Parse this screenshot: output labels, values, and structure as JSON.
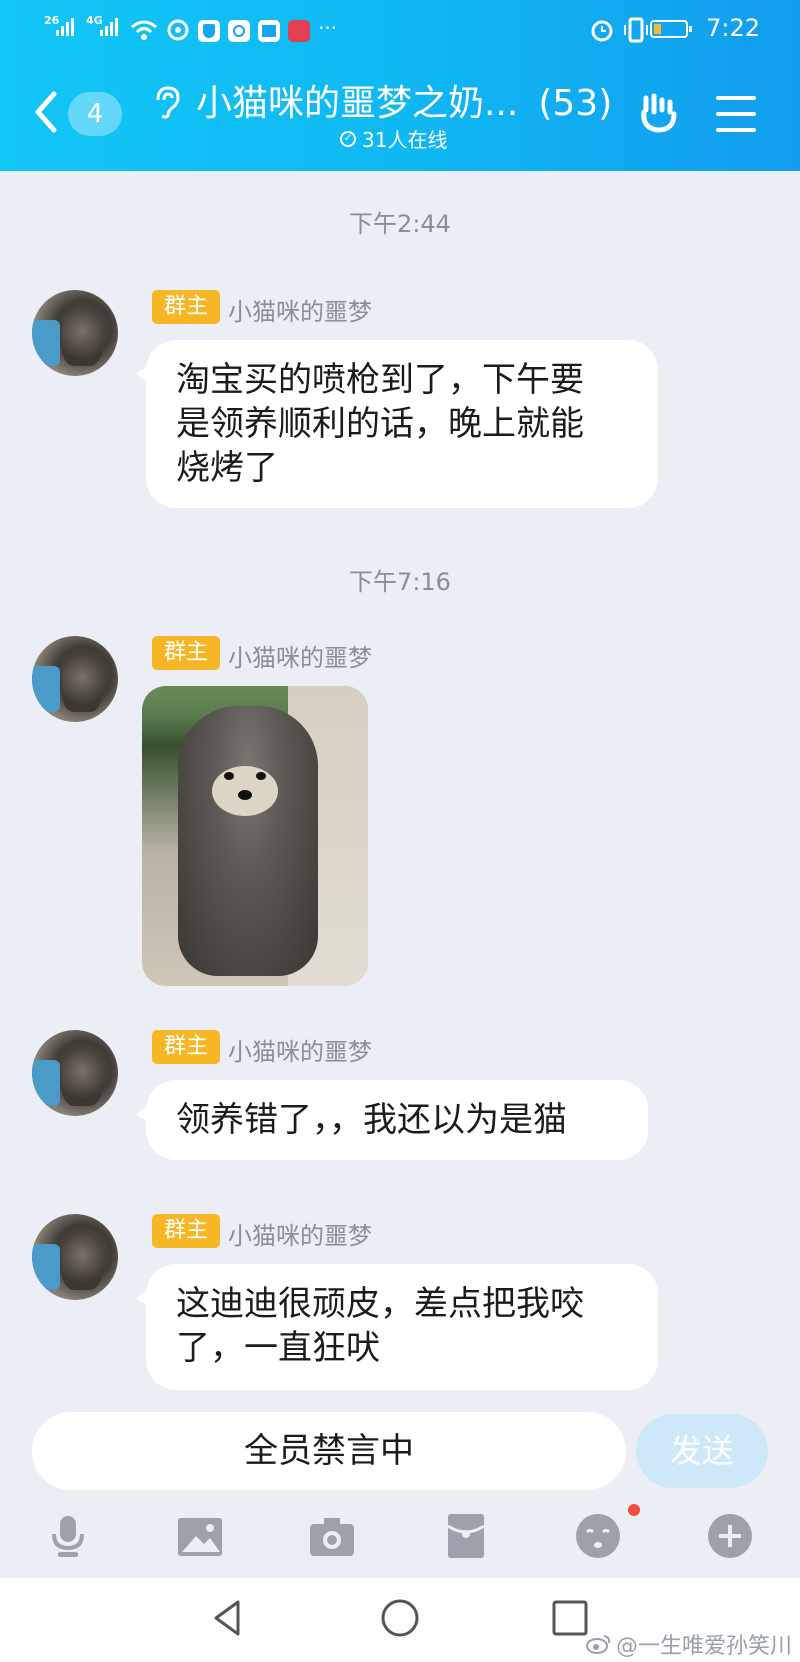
{
  "status_bar": {
    "sim1": "26",
    "sim2": "4G",
    "time": "7:22"
  },
  "header": {
    "unread_count": "4",
    "title": "小猫咪的噩梦之奶...",
    "member_count": "(53)",
    "online_text": "31人在线"
  },
  "messages": [
    {
      "timestamp": "下午2:44",
      "role_badge": "群主",
      "sender": "小猫咪的噩梦",
      "lines": [
        "淘宝买的喷枪到了，下午要",
        "是领养顺利的话，晚上就能",
        "烧烤了"
      ]
    },
    {
      "timestamp": "下午7:16",
      "role_badge": "群主",
      "sender": "小猫咪的噩梦",
      "image": "poodle-dog-photo"
    },
    {
      "role_badge": "群主",
      "sender": "小猫咪的噩梦",
      "lines": [
        "领养错了，，我还以为是猫"
      ]
    },
    {
      "role_badge": "群主",
      "sender": "小猫咪的噩梦",
      "lines": [
        "这迪迪很顽皮，差点把我咬",
        "了，一直狂吠"
      ]
    }
  ],
  "input": {
    "muted_text": "全员禁言中",
    "send_label": "发送"
  },
  "toolbar": [
    "microphone-icon",
    "image-icon",
    "camera-icon",
    "red-packet-icon",
    "emoji-icon",
    "plus-icon"
  ],
  "watermark": "@一生唯爱孙笑川",
  "colors": {
    "header_start": "#12c6f6",
    "header_end": "#129cee",
    "badge": "#f7b625",
    "background": "#eceef5"
  }
}
